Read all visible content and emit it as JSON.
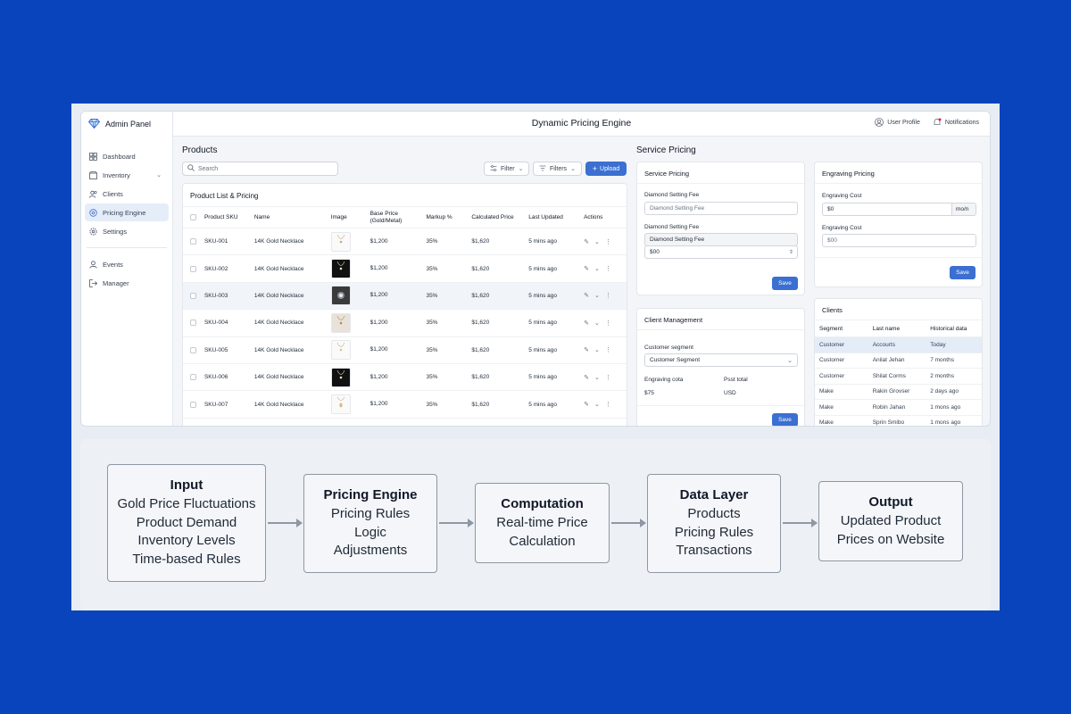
{
  "sidebar": {
    "brand": "Admin Panel",
    "items": [
      {
        "label": "Dashboard"
      },
      {
        "label": "Inventory"
      },
      {
        "label": "Clients"
      },
      {
        "label": "Pricing Engine"
      },
      {
        "label": "Settings"
      },
      {
        "label": "Events"
      },
      {
        "label": "Manager"
      }
    ]
  },
  "topbar": {
    "title": "Dynamic Pricing Engine",
    "user_profile": "User Profile",
    "notifications": "Notifications"
  },
  "products": {
    "heading": "Products",
    "search_placeholder": "Search",
    "filter_label": "Filter",
    "filters_label": "Filters",
    "upload_label": "Upload",
    "card_title": "Product List & Pricing",
    "columns": [
      "Product SKU",
      "Name",
      "Image",
      "Base Price (Gold/Metal)",
      "Markup %",
      "Calculated Price",
      "Last Updated",
      "Actions"
    ],
    "rows": [
      {
        "sku": "SKU-001",
        "name": "14K Gold Necklace",
        "base": "$1,200",
        "markup": "35%",
        "calc": "$1,620",
        "updated": "5 mins ago"
      },
      {
        "sku": "SKU-002",
        "name": "14K Gold Necklace",
        "base": "$1,200",
        "markup": "35%",
        "calc": "$1,620",
        "updated": "5 mins ago"
      },
      {
        "sku": "SKU-003",
        "name": "14K Gold Necklace",
        "base": "$1,200",
        "markup": "35%",
        "calc": "$1,620",
        "updated": "5 mins ago"
      },
      {
        "sku": "SKU-004",
        "name": "14K Gold Necklace",
        "base": "$1,200",
        "markup": "35%",
        "calc": "$1,620",
        "updated": "5 mins ago"
      },
      {
        "sku": "SKU-005",
        "name": "14K Gold Necklace",
        "base": "$1,200",
        "markup": "35%",
        "calc": "$1,620",
        "updated": "5 mins ago"
      },
      {
        "sku": "SKU-006",
        "name": "14K Gold Necklace",
        "base": "$1,200",
        "markup": "35%",
        "calc": "$1,620",
        "updated": "5 mins ago"
      },
      {
        "sku": "SKU-007",
        "name": "14K Gold Necklace",
        "base": "$1,200",
        "markup": "35%",
        "calc": "$1,620",
        "updated": "5 mins ago"
      }
    ]
  },
  "service": {
    "heading": "Service Pricing",
    "card_title": "Service Pricing",
    "label1": "Diamond Setting Fee",
    "placeholder1": "Diamond Setting Fee",
    "label2": "Diamond Setting Fee",
    "grey_field": "Diamond Setting Fee",
    "value2": "$00",
    "save": "Save"
  },
  "engraving": {
    "card_title": "Engraving Pricing",
    "cost_label": "Engraving Cost",
    "cost_value": "$0",
    "unit": "mo/n",
    "cost2_label": "Engraving Cost",
    "cost2_placeholder": "$00",
    "save": "Save"
  },
  "client_mgmt": {
    "card_title": "Client Management",
    "segment_label": "Customer segment",
    "segment_value": "Customer Segment",
    "col1_label": "Engraving cota",
    "col1_value": "$75",
    "col2_label": "Psst total",
    "col2_value": "USD",
    "save": "Save"
  },
  "clients": {
    "card_title": "Clients",
    "columns": [
      "Segment",
      "Last name",
      "Historical data"
    ],
    "rows": [
      {
        "seg": "Customer",
        "last": "Accourts",
        "hist": "Today"
      },
      {
        "seg": "Customer",
        "last": "Anilat Jehan",
        "hist": "7 months"
      },
      {
        "seg": "Customer",
        "last": "Shilat Corms",
        "hist": "2 months"
      },
      {
        "seg": "Make",
        "last": "Rakin Grovser",
        "hist": "2 days ago"
      },
      {
        "seg": "Make",
        "last": "Robin Jahan",
        "hist": "1 mons ago"
      },
      {
        "seg": "Make",
        "last": "Sprin Smibo",
        "hist": "1 mons ago"
      }
    ]
  },
  "flow": {
    "steps": [
      {
        "title": "Input",
        "lines": [
          "Gold Price Fluctuations",
          "Product Demand",
          "Inventory Levels",
          "Time-based Rules"
        ]
      },
      {
        "title": "Pricing Engine",
        "lines": [
          "Pricing Rules",
          "Logic",
          "Adjustments"
        ]
      },
      {
        "title": "Computation",
        "lines": [
          "Real-time Price",
          "Calculation"
        ]
      },
      {
        "title": "Data Layer",
        "lines": [
          "Products",
          "Pricing Rules",
          "Transactions"
        ]
      },
      {
        "title": "Output",
        "lines": [
          "Updated Product",
          "Prices on Website"
        ]
      }
    ]
  },
  "colors": {
    "background": "#0a44bd",
    "accent": "#3b6fd1"
  }
}
